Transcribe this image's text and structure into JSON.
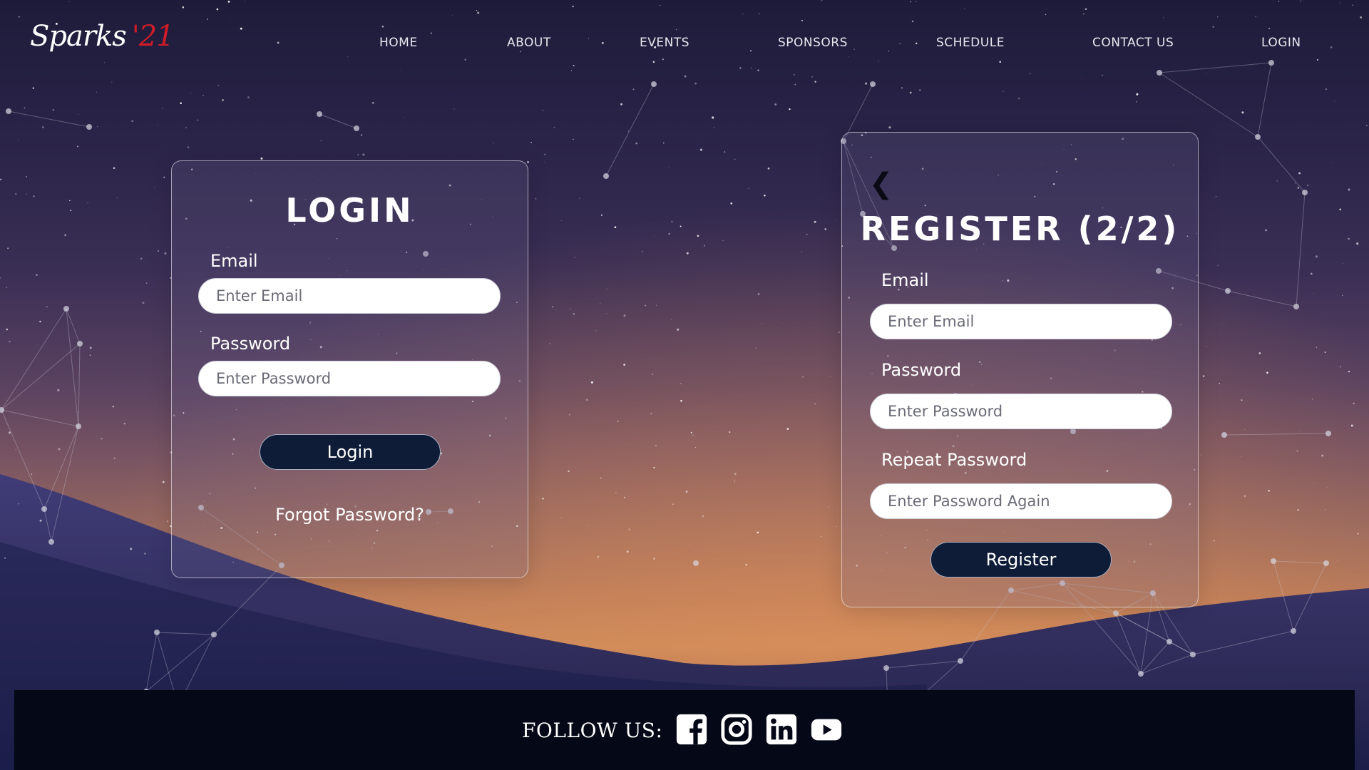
{
  "brand": {
    "logo_text": "Sparks",
    "logo_number": "'21"
  },
  "nav": {
    "items": [
      "HOME",
      "ABOUT",
      "EVENTS",
      "SPONSORS",
      "SCHEDULE",
      "CONTACT US",
      "LOGIN"
    ]
  },
  "login_card": {
    "title": "LOGIN",
    "email_label": "Email",
    "email_placeholder": "Enter Email",
    "password_label": "Password",
    "password_placeholder": "Enter Password",
    "submit_label": "Login",
    "forgot_label": "Forgot Password?"
  },
  "register_card": {
    "back_icon": "chevron-left-icon",
    "back_glyph": "❮",
    "title": "REGISTER (2/2)",
    "email_label": "Email",
    "email_placeholder": "Enter Email",
    "password_label": "Password",
    "password_placeholder": "Enter Password",
    "repeat_label": "Repeat Password",
    "repeat_placeholder": "Enter Password Again",
    "submit_label": "Register"
  },
  "footer": {
    "follow_label": "FOLLOW US:",
    "socials": [
      "facebook-icon",
      "instagram-icon",
      "linkedin-icon",
      "youtube-icon"
    ]
  },
  "colors": {
    "accent_red": "#d01c28",
    "button_navy": "#0e1c38",
    "footer_bg": "#050816"
  }
}
